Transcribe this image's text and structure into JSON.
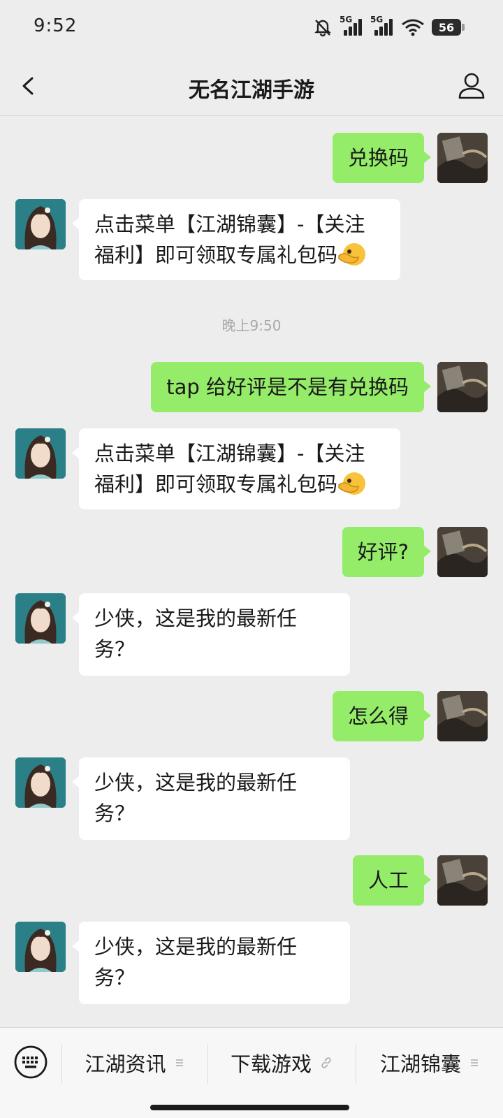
{
  "status_bar": {
    "time": "9:52",
    "network_1": "5G",
    "network_2": "5G",
    "battery": "56"
  },
  "header": {
    "title": "无名江湖手游"
  },
  "chat": {
    "messages": [
      {
        "from": "me",
        "text": "兑换码"
      },
      {
        "from": "bot",
        "text": "点击菜单【江湖锦囊】-【关注福利】即可领取专属礼包码",
        "emoji": "hand-pointing-left-icon"
      },
      {
        "from": "time",
        "text": "晚上9:50"
      },
      {
        "from": "me",
        "text": "tap 给好评是不是有兑换码"
      },
      {
        "from": "bot",
        "text": "点击菜单【江湖锦囊】-【关注福利】即可领取专属礼包码",
        "emoji": "hand-pointing-left-icon"
      },
      {
        "from": "me",
        "text": "好评?"
      },
      {
        "from": "bot",
        "text": "少侠，这是我的最新任务？"
      },
      {
        "from": "me",
        "text": "怎么得"
      },
      {
        "from": "bot",
        "text": "少侠，这是我的最新任务？"
      },
      {
        "from": "me",
        "text": "人工"
      },
      {
        "from": "bot",
        "text": "少侠，这是我的最新任务？"
      }
    ]
  },
  "bottom_menu": {
    "items": [
      {
        "label": "江湖资讯",
        "icon": "menu-lines-icon"
      },
      {
        "label": "下载游戏",
        "icon": "link-icon"
      },
      {
        "label": "江湖锦囊",
        "icon": "menu-lines-icon"
      }
    ]
  },
  "colors": {
    "my_bubble": "#95EC69",
    "bot_bubble": "#FFFFFF",
    "background": "#EDEDED"
  }
}
